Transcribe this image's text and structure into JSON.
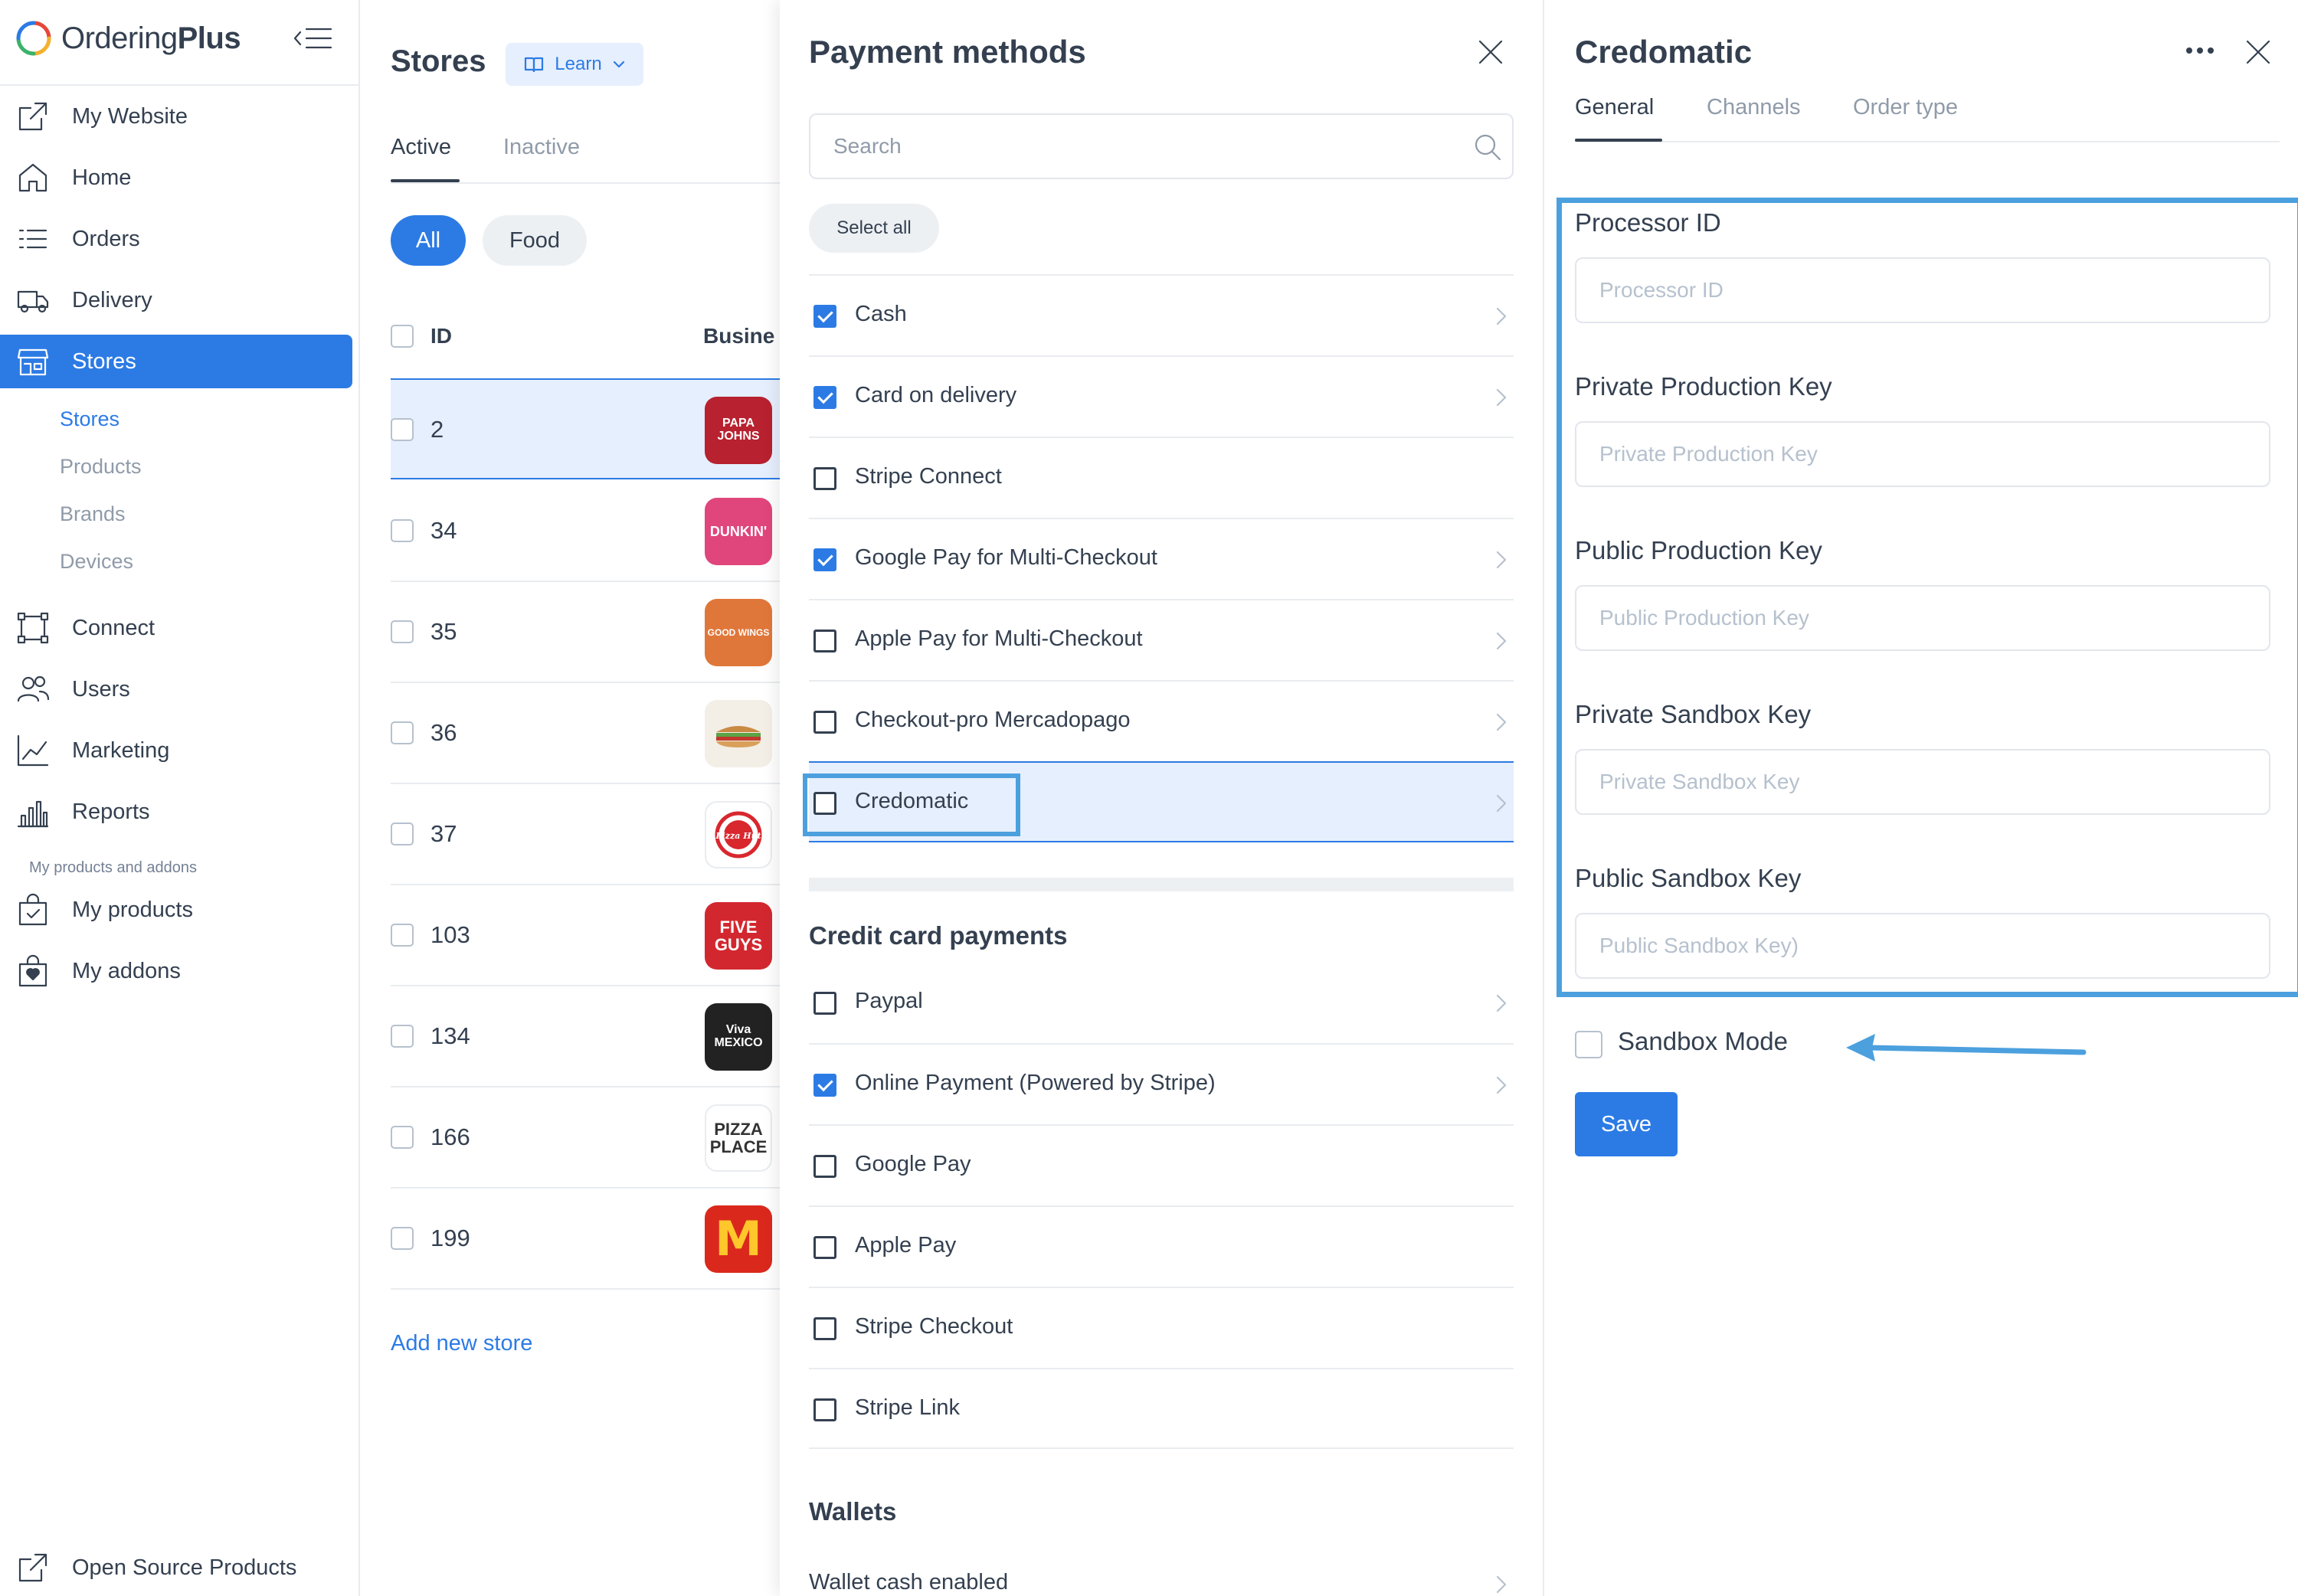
{
  "app": {
    "logo_text_light": "Ordering",
    "logo_text_bold": "Plus",
    "accent_color": "#2C7BE5",
    "highlight_color": "#4CA0DE"
  },
  "sidebar": {
    "items": [
      {
        "label": "My Website",
        "icon": "external-link-icon"
      },
      {
        "label": "Home",
        "icon": "home-icon"
      },
      {
        "label": "Orders",
        "icon": "list-icon"
      },
      {
        "label": "Delivery",
        "icon": "truck-icon"
      },
      {
        "label": "Stores",
        "icon": "store-icon",
        "active": true
      },
      {
        "label": "Connect",
        "icon": "connect-icon"
      },
      {
        "label": "Users",
        "icon": "users-icon"
      },
      {
        "label": "Marketing",
        "icon": "chart-line-icon"
      },
      {
        "label": "Reports",
        "icon": "bar-chart-icon"
      },
      {
        "label": "My products",
        "icon": "bag-check-icon"
      },
      {
        "label": "My addons",
        "icon": "bag-heart-icon"
      },
      {
        "label": "Open Source Products",
        "icon": "external-link-icon"
      }
    ],
    "subitems": [
      {
        "label": "Stores",
        "active": true
      },
      {
        "label": "Products"
      },
      {
        "label": "Brands"
      },
      {
        "label": "Devices"
      }
    ],
    "section_label": "My products and addons"
  },
  "stores": {
    "title": "Stores",
    "learn_label": "Learn",
    "tabs": [
      "Active",
      "Inactive"
    ],
    "chips": [
      "All",
      "Food"
    ],
    "headers": {
      "id": "ID",
      "business": "Busine"
    },
    "rows": [
      {
        "id": "2",
        "logo_text": "PAPA JOHNS",
        "logo_color": "#B8212F"
      },
      {
        "id": "34",
        "logo_text": "DUNKIN'",
        "logo_color": "#E0457B"
      },
      {
        "id": "35",
        "logo_text": "GOOD WINGS",
        "logo_color": "#E0773A"
      },
      {
        "id": "36",
        "logo_text": "",
        "logo_color": "#F3EEE6"
      },
      {
        "id": "37",
        "logo_text": "Pizza Hut",
        "logo_color": "#FFFFFF"
      },
      {
        "id": "103",
        "logo_text": "FIVE GUYS",
        "logo_color": "#D3272F"
      },
      {
        "id": "134",
        "logo_text": "Viva MEXICO",
        "logo_color": "#222222"
      },
      {
        "id": "166",
        "logo_text": "PIZZA PLACE",
        "logo_color": "#FFFFFF"
      },
      {
        "id": "199",
        "logo_text": "M",
        "logo_color": "#DA291C"
      }
    ],
    "add_store_label": "Add new store"
  },
  "payments": {
    "title": "Payment methods",
    "search_placeholder": "Search",
    "select_all_label": "Select all",
    "methods": [
      {
        "label": "Cash",
        "checked": true
      },
      {
        "label": "Card on delivery",
        "checked": true
      },
      {
        "label": "Stripe Connect",
        "checked": false
      },
      {
        "label": "Google Pay for Multi-Checkout",
        "checked": true
      },
      {
        "label": "Apple Pay for Multi-Checkout",
        "checked": false
      },
      {
        "label": "Checkout-pro Mercadopago",
        "checked": false
      },
      {
        "label": "Credomatic",
        "checked": false,
        "selected": true
      }
    ],
    "credit_section_title": "Credit card payments",
    "credit_methods": [
      {
        "label": "Paypal",
        "checked": false
      },
      {
        "label": "Online Payment (Powered by Stripe)",
        "checked": true
      },
      {
        "label": "Google Pay",
        "checked": false
      },
      {
        "label": "Apple Pay",
        "checked": false
      },
      {
        "label": "Stripe Checkout",
        "checked": false
      },
      {
        "label": "Stripe Link",
        "checked": false
      }
    ],
    "wallets_section_title": "Wallets",
    "wallet_methods": [
      {
        "label": "Wallet cash enabled"
      }
    ]
  },
  "credomatic": {
    "title": "Credomatic",
    "tabs": [
      "General",
      "Channels",
      "Order type"
    ],
    "fields": [
      {
        "label": "Processor ID",
        "placeholder": "Processor ID",
        "value": ""
      },
      {
        "label": "Private Production Key",
        "placeholder": "Private Production Key",
        "value": ""
      },
      {
        "label": "Public Production Key",
        "placeholder": "Public Production Key",
        "value": ""
      },
      {
        "label": "Private Sandbox Key",
        "placeholder": "Private Sandbox Key",
        "value": ""
      },
      {
        "label": "Public Sandbox Key",
        "placeholder": "Public Sandbox Key)",
        "value": ""
      }
    ],
    "sandbox_label": "Sandbox Mode",
    "sandbox_checked": false,
    "save_label": "Save"
  }
}
